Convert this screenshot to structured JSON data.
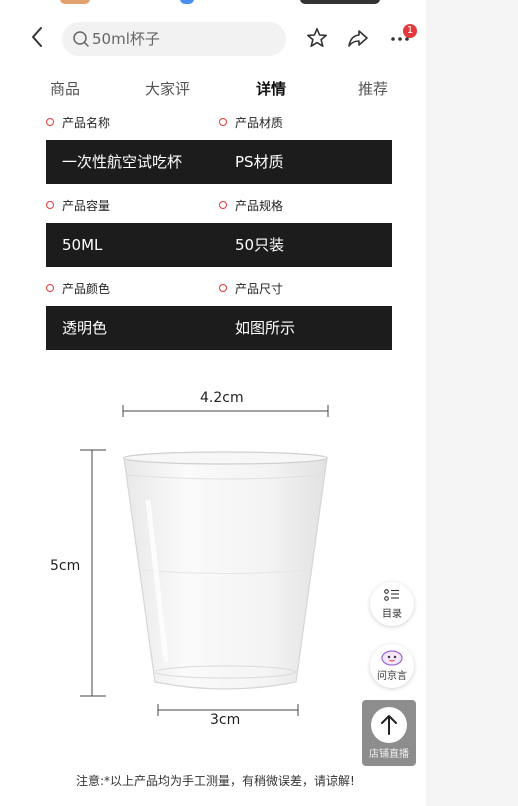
{
  "header": {
    "back_icon": "chevron-left-icon",
    "search_placeholder": "50ml杯子",
    "star_icon": "star-icon",
    "share_icon": "share-icon",
    "more_icon": "more-icon",
    "badge_count": "1"
  },
  "tabs": [
    {
      "label": "商品"
    },
    {
      "label": "大家评"
    },
    {
      "label": "详情",
      "active": true
    },
    {
      "label": "推荐"
    }
  ],
  "specs": [
    {
      "label_a": "产品名称",
      "value_a": "一次性航空试吃杯",
      "label_b": "产品材质",
      "value_b": "PS材质"
    },
    {
      "label_a": "产品容量",
      "value_a": "50ML",
      "label_b": "产品规格",
      "value_b": "50只装"
    },
    {
      "label_a": "产品颜色",
      "value_a": "透明色",
      "label_b": "产品尺寸",
      "value_b": "如图所示"
    }
  ],
  "dimensions": {
    "top": "4.2cm",
    "height": "5cm",
    "bottom": "3cm"
  },
  "footnote": "注意:*以上产品均为手工测量，有稍微误差，请谅解!",
  "floating": {
    "toc_label": "目录",
    "ask_label": "问京言",
    "live_label": "店铺直播"
  },
  "colors": {
    "accent": "#e4393c",
    "spec_bg": "#1c1c1c"
  }
}
